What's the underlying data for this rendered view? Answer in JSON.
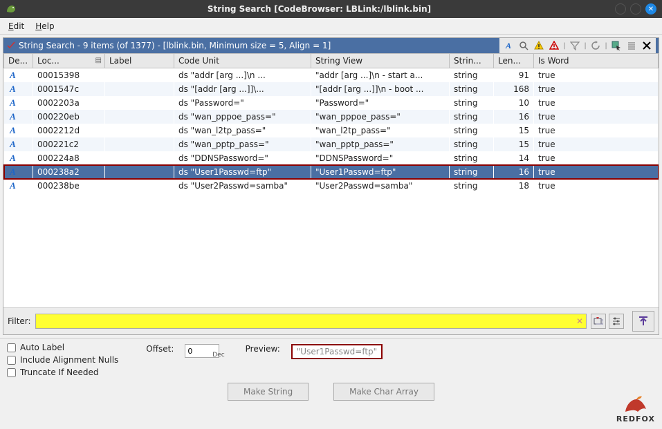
{
  "titlebar": {
    "label": "String Search [CodeBrowser: LBLink:/lblink.bin]"
  },
  "menubar": {
    "edit": "Edit",
    "help": "Help"
  },
  "panel_header": "String Search - 9 items (of 1377) - [lblink.bin, Minimum size = 5, Align = 1]",
  "columns": {
    "defined": "De...",
    "location": "Loc...",
    "label": "Label",
    "code_unit": "Code Unit",
    "string_view": "String View",
    "string_type": "Strin...",
    "length": "Len...",
    "is_word": "Is Word"
  },
  "rows": [
    {
      "loc": "00015398",
      "label": "",
      "code": "ds  \"addr [arg ...]\\n ...",
      "view": "\"addr [arg ...]\\n     - start a...",
      "type": "string",
      "len": "91",
      "word": "true",
      "sel": false
    },
    {
      "loc": "0001547c",
      "label": "",
      "code": "ds  \"[addr [arg ...]]\\...",
      "view": "\"[addr [arg ...]]\\n    - boot ...",
      "type": "string",
      "len": "168",
      "word": "true",
      "sel": false
    },
    {
      "loc": "0002203a",
      "label": "",
      "code": "ds  \"Password=\"",
      "view": "\"Password=\"",
      "type": "string",
      "len": "10",
      "word": "true",
      "sel": false
    },
    {
      "loc": "000220eb",
      "label": "",
      "code": "ds  \"wan_pppoe_pass=\"",
      "view": "\"wan_pppoe_pass=\"",
      "type": "string",
      "len": "16",
      "word": "true",
      "sel": false
    },
    {
      "loc": "0002212d",
      "label": "",
      "code": "ds  \"wan_l2tp_pass=\"",
      "view": "\"wan_l2tp_pass=\"",
      "type": "string",
      "len": "15",
      "word": "true",
      "sel": false
    },
    {
      "loc": "000221c2",
      "label": "",
      "code": "ds  \"wan_pptp_pass=\"",
      "view": "\"wan_pptp_pass=\"",
      "type": "string",
      "len": "15",
      "word": "true",
      "sel": false
    },
    {
      "loc": "000224a8",
      "label": "",
      "code": "ds  \"DDNSPassword=\"",
      "view": "\"DDNSPassword=\"",
      "type": "string",
      "len": "14",
      "word": "true",
      "sel": false
    },
    {
      "loc": "000238a2",
      "label": "",
      "code": "ds  \"User1Passwd=ftp\"",
      "view": "\"User1Passwd=ftp\"",
      "type": "string",
      "len": "16",
      "word": "true",
      "sel": true
    },
    {
      "loc": "000238be",
      "label": "",
      "code": "ds  \"User2Passwd=samba\"",
      "view": "\"User2Passwd=samba\"",
      "type": "string",
      "len": "18",
      "word": "true",
      "sel": false
    }
  ],
  "filter": {
    "label": "Filter:",
    "clear": "✕"
  },
  "options": {
    "auto_label": "Auto Label",
    "include_nulls": "Include Alignment Nulls",
    "truncate": "Truncate If Needed",
    "offset_label": "Offset:",
    "offset_value": "0",
    "offset_mode": "Dec",
    "preview_label": "Preview:",
    "preview_value": "\"User1Passwd=ftp\""
  },
  "buttons": {
    "make_string": "Make String",
    "make_char": "Make Char Array"
  },
  "logo": "REDFOX"
}
